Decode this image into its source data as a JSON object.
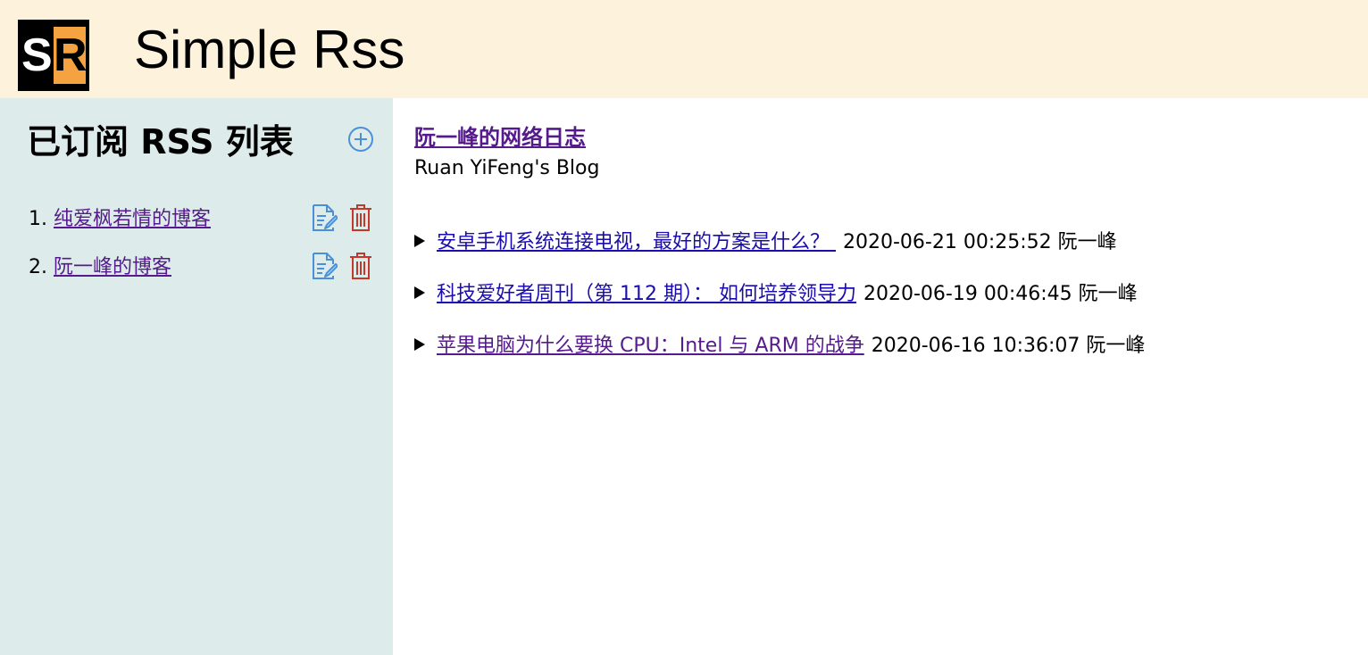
{
  "header": {
    "logo_left": "S",
    "logo_right": "R",
    "title": "Simple Rss"
  },
  "sidebar": {
    "heading": "已订阅 RSS 列表",
    "add_icon": "plus-circle-icon",
    "feeds": [
      {
        "number": "1.",
        "name": "纯爱枫若情的博客"
      },
      {
        "number": "2.",
        "name": "阮一峰的博客"
      }
    ]
  },
  "main": {
    "blog_title": "阮一峰的网络日志",
    "blog_description": "Ruan YiFeng's Blog",
    "posts": [
      {
        "title": "安卓手机系统连接电视，最好的方案是什么？ ",
        "date": "2020-06-21 00:25:52",
        "author": "阮一峰"
      },
      {
        "title": "科技爱好者周刊（第 112 期）： 如何培养领导力",
        "date": "2020-06-19 00:46:45",
        "author": "阮一峰"
      },
      {
        "title": "苹果电脑为什么要换 CPU：Intel 与 ARM 的战争",
        "date": "2020-06-16 10:36:07",
        "author": "阮一峰"
      }
    ]
  },
  "colors": {
    "header_bg": "#fdf3dc",
    "sidebar_bg": "#ddebea",
    "link": "#1a0dab",
    "visited_link": "#551a8b",
    "edit_icon": "#4a90d9",
    "delete_icon": "#c0392b",
    "add_icon": "#4a90d9",
    "logo_orange": "#f4a340"
  }
}
